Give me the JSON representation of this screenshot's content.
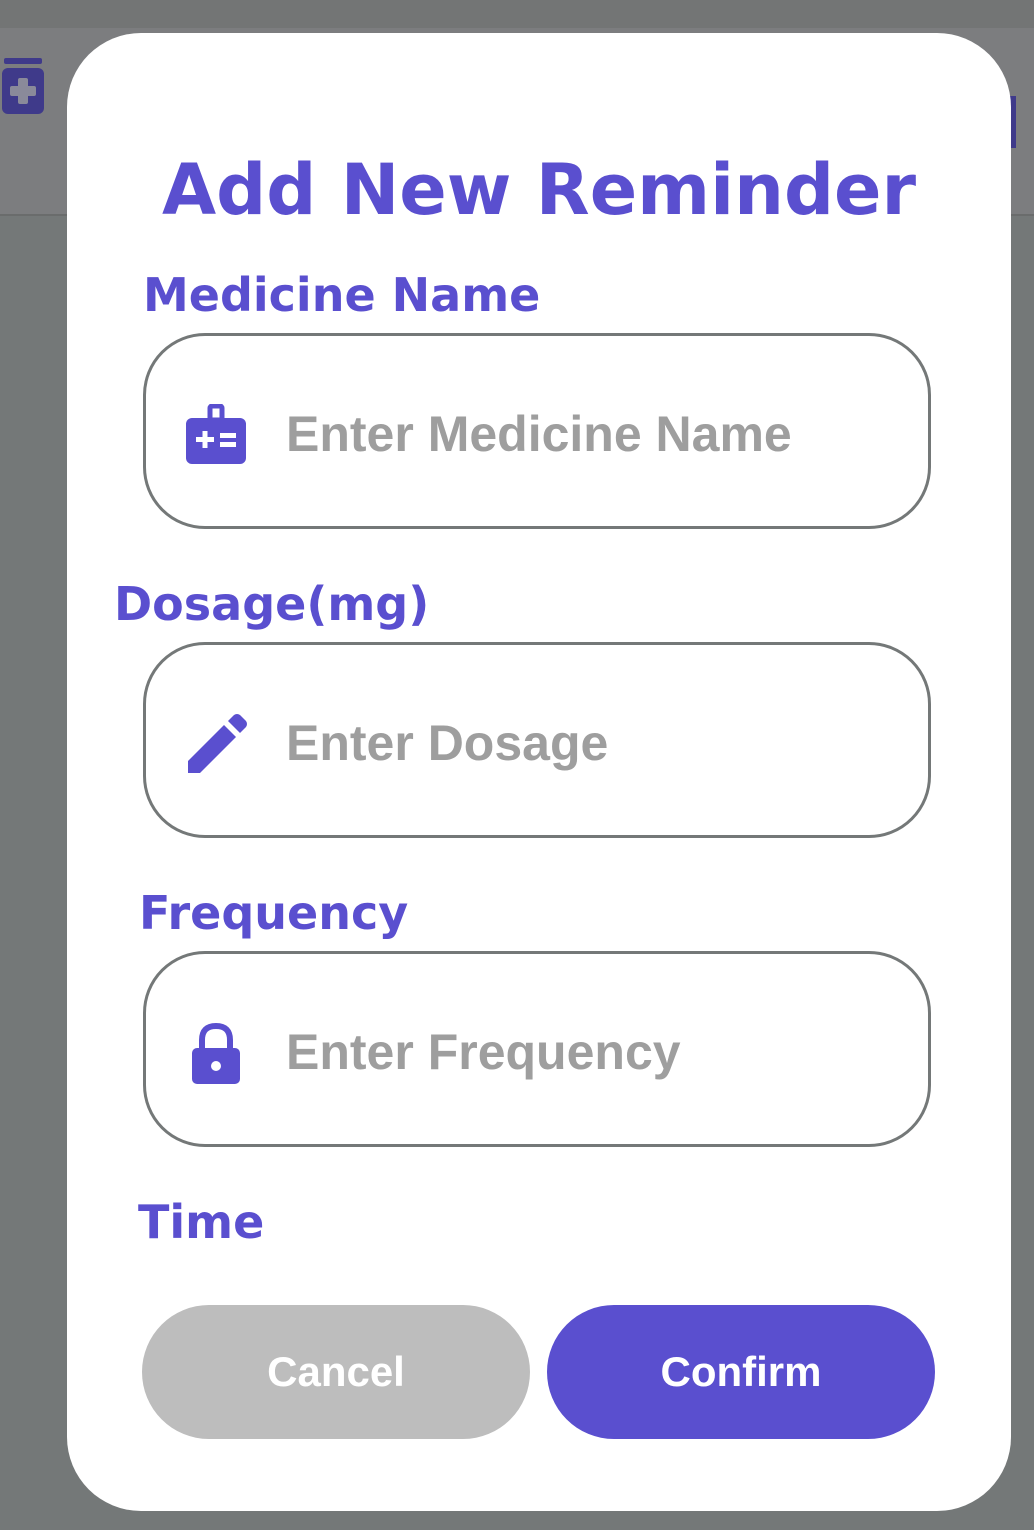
{
  "dialog": {
    "title": "Add New Reminder"
  },
  "fields": {
    "medicine": {
      "label": "Medicine Name",
      "placeholder": "Enter Medicine Name",
      "value": "",
      "icon": "medical-bag-icon"
    },
    "dosage": {
      "label": "Dosage(mg)",
      "placeholder": "Enter Dosage",
      "value": "",
      "icon": "pencil-icon"
    },
    "frequency": {
      "label": "Frequency",
      "placeholder": "Enter Frequency",
      "value": "",
      "icon": "lock-icon"
    },
    "time": {
      "label": "Time"
    }
  },
  "buttons": {
    "cancel_label": "Cancel",
    "confirm_label": "Confirm"
  },
  "colors": {
    "accent": "#5a4fcf",
    "overlay": "#747878",
    "cancel_bg": "#bdbdbd",
    "placeholder": "#9e9e9e"
  }
}
